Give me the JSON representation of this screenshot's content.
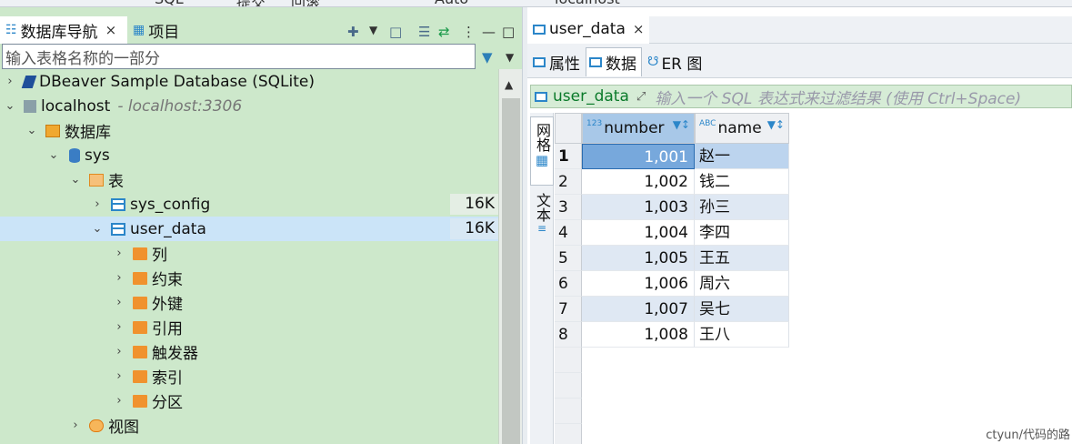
{
  "top_strip": {
    "items": [
      "SQL",
      "提交",
      "回滚",
      "Auto",
      "localhost"
    ]
  },
  "navigator": {
    "tabs": [
      {
        "label": "数据库导航",
        "close": "×"
      },
      {
        "label": "项目"
      }
    ],
    "filter_placeholder": "输入表格名称的一部分",
    "tree": [
      {
        "label": "DBeaver Sample Database (SQLite)",
        "icon": "dbeaver-icon",
        "chevron": "›"
      },
      {
        "label": "localhost",
        "suffix": "- localhost:3306",
        "icon": "host-icon",
        "chevron": "⌄"
      },
      {
        "label": "数据库",
        "icon": "database-folder-icon",
        "chevron": "⌄"
      },
      {
        "label": "sys",
        "icon": "database-icon",
        "chevron": "⌄"
      },
      {
        "label": "表",
        "icon": "tables-folder-icon",
        "chevron": "⌄"
      },
      {
        "label": "sys_config",
        "icon": "table-icon",
        "chevron": "›",
        "size": "16K"
      },
      {
        "label": "user_data",
        "icon": "table-icon",
        "chevron": "⌄",
        "size": "16K"
      },
      {
        "label": "列",
        "icon": "folder-icon",
        "chevron": "›"
      },
      {
        "label": "约束",
        "icon": "folder-icon",
        "chevron": "›"
      },
      {
        "label": "外键",
        "icon": "folder-icon",
        "chevron": "›"
      },
      {
        "label": "引用",
        "icon": "folder-icon",
        "chevron": "›"
      },
      {
        "label": "触发器",
        "icon": "folder-icon",
        "chevron": "›"
      },
      {
        "label": "索引",
        "icon": "folder-icon",
        "chevron": "›"
      },
      {
        "label": "分区",
        "icon": "folder-icon",
        "chevron": "›"
      },
      {
        "label": "视图",
        "icon": "view-icon",
        "chevron": "›"
      }
    ]
  },
  "editor": {
    "tab": {
      "label": "user_data",
      "close": "×"
    },
    "sub_tabs": [
      {
        "label": "属性"
      },
      {
        "label": "数据"
      },
      {
        "label": "ER 图"
      }
    ],
    "filter": {
      "table": "user_data",
      "placeholder": "输入一个 SQL 表达式来过滤结果 (使用 Ctrl+Space)"
    },
    "side_tools": [
      {
        "label": "网格"
      },
      {
        "label": "文本"
      }
    ],
    "columns": [
      {
        "name": "number",
        "type_tag": "123"
      },
      {
        "name": "name",
        "type_tag": "ABC"
      }
    ],
    "rows": [
      {
        "n": "1",
        "number": "1,001",
        "name": "赵一"
      },
      {
        "n": "2",
        "number": "1,002",
        "name": "钱二"
      },
      {
        "n": "3",
        "number": "1,003",
        "name": "孙三"
      },
      {
        "n": "4",
        "number": "1,004",
        "name": "李四"
      },
      {
        "n": "5",
        "number": "1,005",
        "name": "王五"
      },
      {
        "n": "6",
        "number": "1,006",
        "name": "周六"
      },
      {
        "n": "7",
        "number": "1,007",
        "name": "吴七"
      },
      {
        "n": "8",
        "number": "1,008",
        "name": "王八"
      }
    ]
  },
  "watermark": "ctyun/代码的路"
}
